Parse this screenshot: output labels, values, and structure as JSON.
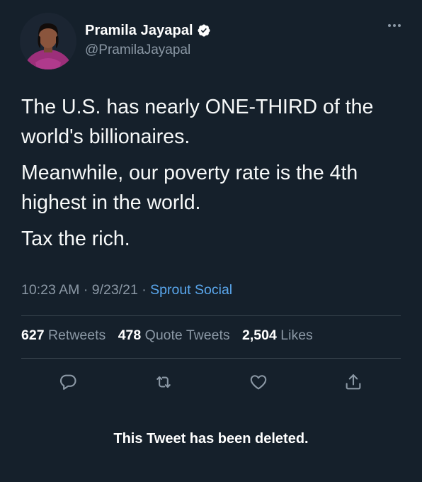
{
  "author": {
    "display_name": "Pramila Jayapal",
    "handle": "@PramilaJayapal",
    "verified": true
  },
  "tweet": {
    "paragraphs": [
      "The U.S. has nearly ONE-THIRD of the world's billionaires.",
      "Meanwhile, our poverty rate is the 4th highest in the world.",
      "Tax the rich."
    ],
    "time": "10:23 AM",
    "date": "9/23/21",
    "separator": "·",
    "source": "Sprout Social"
  },
  "stats": [
    {
      "count": "627",
      "label": "Retweets"
    },
    {
      "count": "478",
      "label": "Quote Tweets"
    },
    {
      "count": "2,504",
      "label": "Likes"
    }
  ],
  "actions": [
    "reply-icon",
    "retweet-icon",
    "like-icon",
    "share-icon"
  ],
  "footer": {
    "notice": "This Tweet has been deleted."
  },
  "colors": {
    "background": "#15202b",
    "primary_text": "#f7f9f9",
    "secondary_text": "#8b98a5",
    "link": "#5aa7ed",
    "verified": "#ffffff",
    "divider": "#38444d"
  }
}
